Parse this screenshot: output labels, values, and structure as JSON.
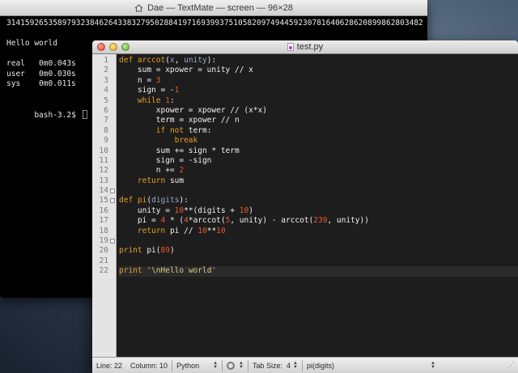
{
  "terminal": {
    "title": "Dae — TextMate — screen — 96×28",
    "output": "314159265358979323846264338327950288419716939937510582097494459230781640628620899862803482",
    "hello": "Hello world",
    "timings": [
      {
        "label": "real",
        "value": "0m0.043s"
      },
      {
        "label": "user",
        "value": "0m0.030s"
      },
      {
        "label": "sys",
        "value": "0m0.011s"
      }
    ],
    "prompt": "bash-3.2$"
  },
  "editor": {
    "title": "test.py",
    "line_numbers": [
      "1",
      "2",
      "3",
      "4",
      "5",
      "6",
      "7",
      "8",
      "9",
      "10",
      "11",
      "12",
      "13",
      "14",
      "15",
      "16",
      "17",
      "18",
      "19",
      "20",
      "21",
      "22"
    ]
  },
  "statusbar": {
    "line": "Line: 22",
    "column": "Column: 10",
    "language": "Python",
    "tab_size": "Tab Size:",
    "tab_value": "4",
    "symbol": "pi(digits)"
  }
}
